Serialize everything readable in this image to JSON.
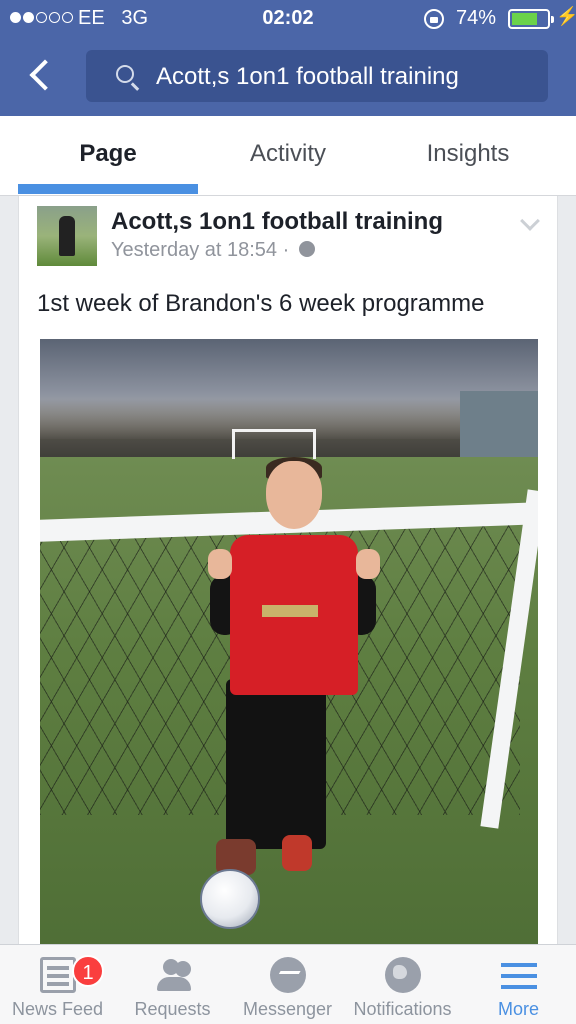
{
  "status_bar": {
    "signal_bars_on": 2,
    "signal_bars_total": 5,
    "carrier": "EE",
    "network": "3G",
    "time": "02:02",
    "battery_percent": "74%",
    "battery_level": 0.74
  },
  "nav": {
    "search_text": "Acott,s 1on1 football training"
  },
  "tabs": [
    {
      "label": "Page",
      "active": true
    },
    {
      "label": "Activity",
      "active": false
    },
    {
      "label": "Insights",
      "active": false
    }
  ],
  "post": {
    "page_name": "Acott,s 1on1 football training",
    "timestamp": "Yesterday at 18:54",
    "separator": "·",
    "privacy_icon": "globe-icon",
    "text": "1st week of Brandon's 6 week programme"
  },
  "bottom_bar": {
    "items": [
      {
        "label": "News Feed",
        "icon": "news-feed-icon",
        "badge": "1",
        "active": false
      },
      {
        "label": "Requests",
        "icon": "friend-requests-icon",
        "active": false
      },
      {
        "label": "Messenger",
        "icon": "messenger-icon",
        "active": false
      },
      {
        "label": "Notifications",
        "icon": "globe-icon",
        "active": false
      },
      {
        "label": "More",
        "icon": "hamburger-icon",
        "active": true
      }
    ]
  },
  "colors": {
    "header_blue": "#4b66a8",
    "active_blue": "#4a90e2",
    "badge_red": "#fa3e3e",
    "battery_green": "#6bd24a"
  }
}
